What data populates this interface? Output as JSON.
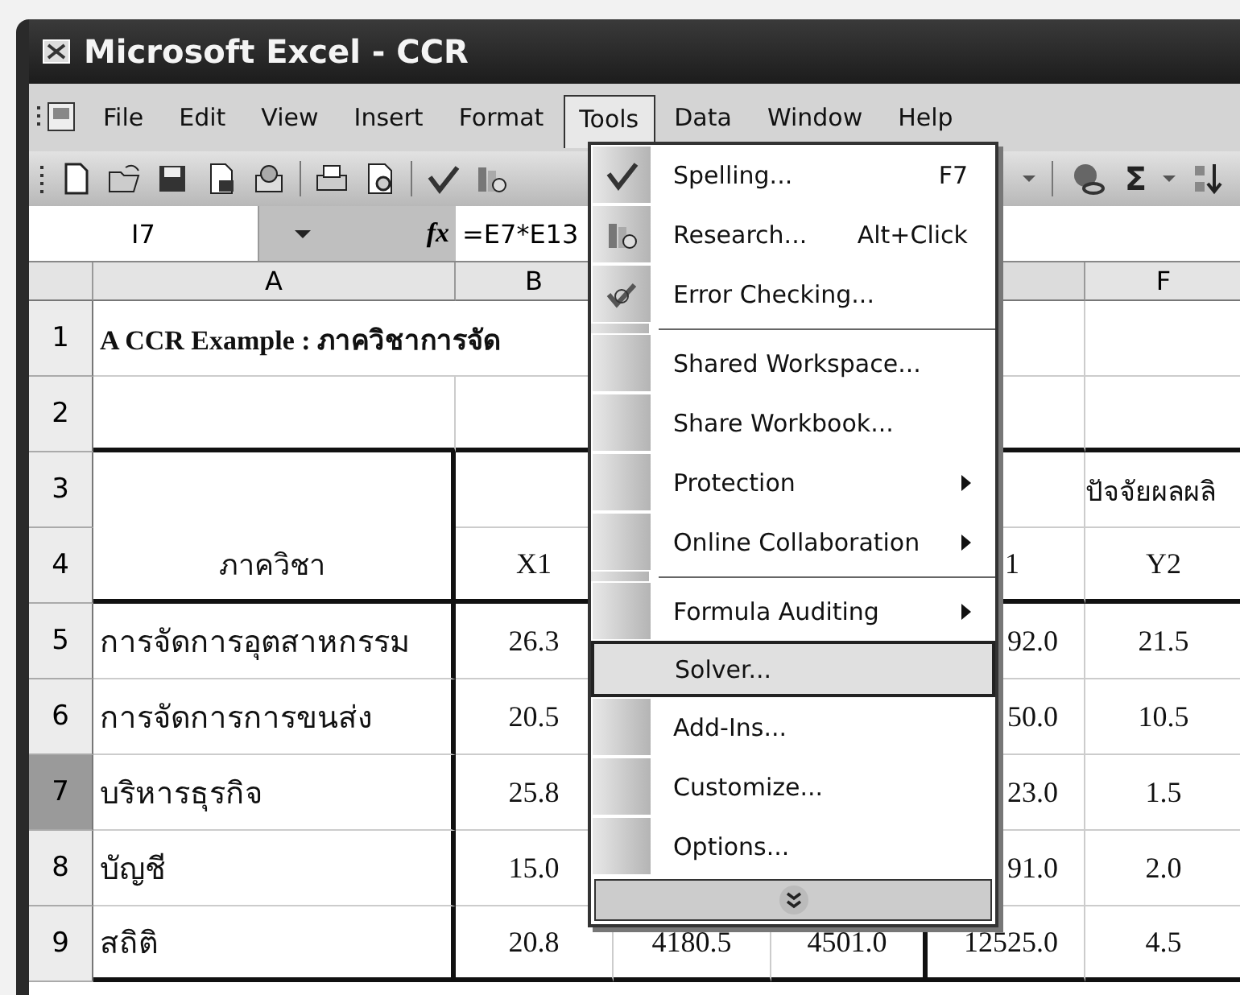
{
  "window": {
    "title": "Microsoft Excel - CCR"
  },
  "menu_bar": [
    {
      "label": "File",
      "selected": false
    },
    {
      "label": "Edit",
      "selected": false
    },
    {
      "label": "View",
      "selected": false
    },
    {
      "label": "Insert",
      "selected": false
    },
    {
      "label": "Format",
      "selected": false
    },
    {
      "label": "Tools",
      "selected": true
    },
    {
      "label": "Data",
      "selected": false
    },
    {
      "label": "Window",
      "selected": false
    },
    {
      "label": "Help",
      "selected": false
    }
  ],
  "toolbar": {
    "sum_label": "Σ"
  },
  "formula_bar": {
    "name_box": "I7",
    "function_label": "fx",
    "formula": "=E7*E13"
  },
  "sheet": {
    "column_headers": [
      {
        "label": "A"
      },
      {
        "label": "B"
      },
      {
        "label": "F"
      }
    ],
    "rows": [
      {
        "header": "1",
        "selected": false,
        "kind": "title",
        "cells": [
          "A CCR Example : ภาควิชาการจัด",
          null,
          null,
          null,
          null,
          null
        ]
      },
      {
        "header": "2",
        "selected": false,
        "kind": "title",
        "cells": [
          null,
          null,
          null,
          null,
          null,
          null
        ]
      },
      {
        "header": "3",
        "selected": false,
        "kind": "header",
        "cells": [
          null,
          null,
          null,
          null,
          null,
          "ปัจจัยผลผลิ"
        ]
      },
      {
        "header": "4",
        "selected": false,
        "kind": "header",
        "cells": [
          "ภาควิชา",
          "X1",
          null,
          null,
          "1",
          "Y2"
        ]
      },
      {
        "header": "5",
        "selected": false,
        "kind": "data",
        "cells": [
          "การจัดการอุตสาหกรรม",
          "26.3",
          null,
          null,
          "92.0",
          "21.5"
        ]
      },
      {
        "header": "6",
        "selected": false,
        "kind": "data",
        "cells": [
          "การจัดการการขนส่ง",
          "20.5",
          null,
          null,
          "50.0",
          "10.5"
        ]
      },
      {
        "header": "7",
        "selected": true,
        "kind": "data",
        "cells": [
          "บริหารธุรกิจ",
          "25.8",
          null,
          null,
          "23.0",
          "1.5"
        ]
      },
      {
        "header": "8",
        "selected": false,
        "kind": "data",
        "cells": [
          "บัญชี",
          "15.0",
          null,
          null,
          "91.0",
          "2.0"
        ]
      },
      {
        "header": "9",
        "selected": false,
        "kind": "data",
        "cells": [
          "สถิติ",
          "20.8",
          "4180.5",
          "4501.0",
          "12525.0",
          "4.5"
        ]
      }
    ]
  },
  "tools_menu": {
    "items": [
      {
        "label": "Spelling...",
        "shortcut": "F7",
        "kind": "icon",
        "submenu": false,
        "separator_before": false,
        "selected": false
      },
      {
        "label": "Research...",
        "shortcut": "Alt+Click",
        "kind": "icon",
        "submenu": false,
        "separator_before": false,
        "selected": false
      },
      {
        "label": "Error Checking...",
        "kind": "icon",
        "submenu": false,
        "separator_before": false,
        "selected": false
      },
      {
        "label": "Shared Workspace...",
        "kind": "plain",
        "submenu": false,
        "separator_before": true,
        "selected": false
      },
      {
        "label": "Share Workbook...",
        "kind": "plain",
        "submenu": false,
        "separator_before": false,
        "selected": false
      },
      {
        "label": "Protection",
        "kind": "plain",
        "submenu": true,
        "separator_before": false,
        "selected": false
      },
      {
        "label": "Online Collaboration",
        "kind": "plain",
        "submenu": true,
        "separator_before": false,
        "selected": false
      },
      {
        "label": "Formula Auditing",
        "kind": "plain",
        "submenu": true,
        "separator_before": true,
        "selected": false
      },
      {
        "label": "Solver...",
        "kind": "plain",
        "submenu": false,
        "separator_before": false,
        "selected": true
      },
      {
        "label": "Add-Ins...",
        "kind": "plain",
        "submenu": false,
        "separator_before": false,
        "selected": false
      },
      {
        "label": "Customize...",
        "kind": "plain",
        "submenu": false,
        "separator_before": false,
        "selected": false
      },
      {
        "label": "Options...",
        "kind": "plain",
        "submenu": false,
        "separator_before": false,
        "selected": false
      }
    ]
  }
}
